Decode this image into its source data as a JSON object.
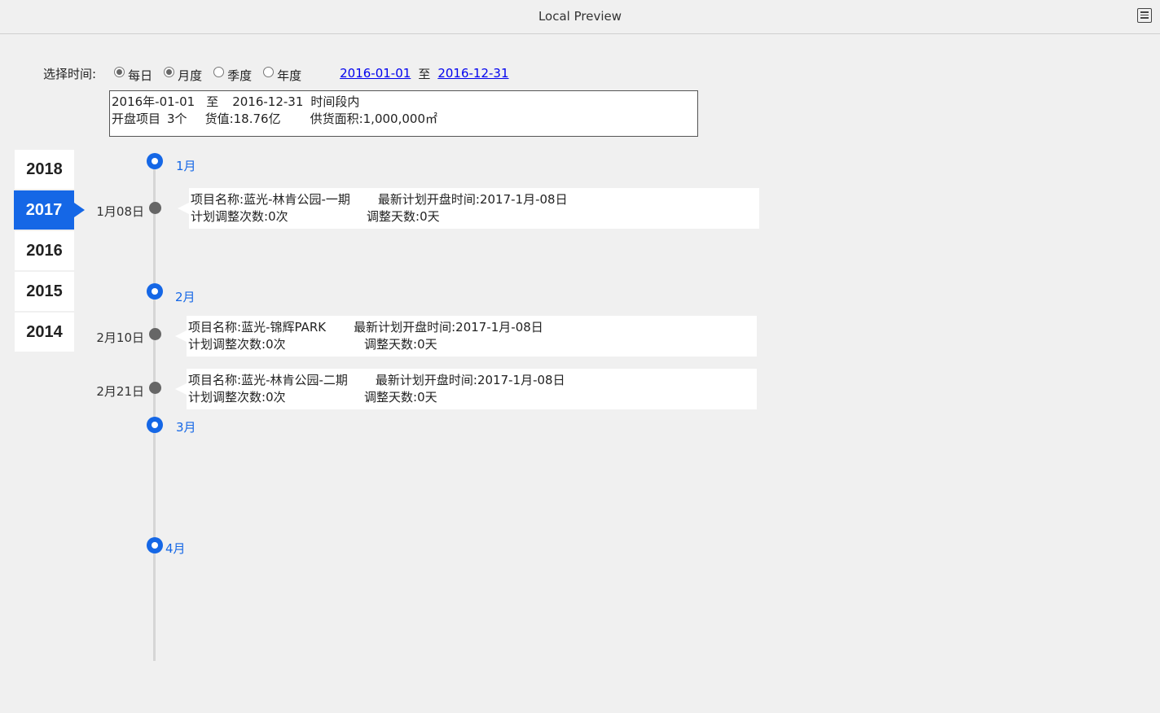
{
  "window": {
    "title": "Local Preview",
    "menu_icon": "list-menu-icon"
  },
  "filter": {
    "label": "选择时间:",
    "options": [
      {
        "label": "每日",
        "checked": true
      },
      {
        "label": "月度",
        "checked": true
      },
      {
        "label": "季度",
        "checked": false
      },
      {
        "label": "年度",
        "checked": false
      }
    ],
    "start_date": "2016-01-01",
    "separator": "至",
    "end_date": "2016-12-31"
  },
  "summary": {
    "line1_start": "2016年-01-01",
    "line1_sep": "至",
    "line1_end": "2016-12-31",
    "line1_suffix": "时间段内",
    "projects_label": "开盘项目",
    "projects_value": "3个",
    "value_label": "货值:",
    "value_value": "18.76亿",
    "area_label": "供货面积:",
    "area_value": "1,000,000㎡"
  },
  "years": [
    {
      "label": "2018",
      "active": false
    },
    {
      "label": "2017",
      "active": true
    },
    {
      "label": "2016",
      "active": false
    },
    {
      "label": "2015",
      "active": false
    },
    {
      "label": "2014",
      "active": false
    }
  ],
  "timeline": {
    "months": [
      "1月",
      "2月",
      "3月",
      "4月"
    ],
    "events": [
      {
        "date": "1月08日",
        "name_label": "项目名称:",
        "name": "蓝光-林肯公园-一期",
        "plan_label": "最新计划开盘时间:",
        "plan": "2017-1月-08日",
        "adjust_count_label": "计划调整次数:",
        "adjust_count": "0次",
        "adjust_days_label": "调整天数:",
        "adjust_days": "0天"
      },
      {
        "date": "2月10日",
        "name_label": "项目名称:",
        "name": "蓝光-锦辉PARK",
        "plan_label": "最新计划开盘时间:",
        "plan": "2017-1月-08日",
        "adjust_count_label": "计划调整次数:",
        "adjust_count": "0次",
        "adjust_days_label": "调整天数:",
        "adjust_days": "0天"
      },
      {
        "date": "2月21日",
        "name_label": "项目名称:",
        "name": "蓝光-林肯公园-二期",
        "plan_label": "最新计划开盘时间:",
        "plan": "2017-1月-08日",
        "adjust_count_label": "计划调整次数:",
        "adjust_count": "0次",
        "adjust_days_label": "调整天数:",
        "adjust_days": "0天"
      }
    ]
  }
}
